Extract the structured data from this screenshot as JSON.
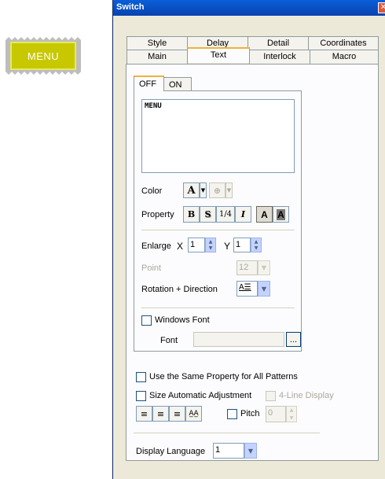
{
  "canvas": {
    "menu_switch_label": "MENU"
  },
  "dialog": {
    "title": "Switch",
    "close_glyph": "✕",
    "tabs_row1": [
      "Style",
      "Delay",
      "Detail",
      "Coordinates"
    ],
    "tabs_row2": [
      "Main",
      "Text",
      "Interlock",
      "Macro"
    ],
    "active_tab": "Text"
  },
  "state_tabs": {
    "off": "OFF",
    "on": "ON",
    "active": "OFF"
  },
  "text_value": "MENU",
  "color": {
    "label": "Color",
    "font_color_glyph": "A",
    "bg_color_glyph": "⊕"
  },
  "property": {
    "label": "Property",
    "bold": "B",
    "shadow": "S",
    "fraction": "1/4",
    "italic": "I",
    "normal_a": "A",
    "inverse_a": "A"
  },
  "enlarge": {
    "label": "Enlarge",
    "x_label": "X",
    "x_value": "1",
    "y_label": "Y",
    "y_value": "1"
  },
  "point": {
    "label": "Point",
    "value": "12"
  },
  "rotation": {
    "label": "Rotation + Direction",
    "glyph": "A☰"
  },
  "windows_font": {
    "label": "Windows Font",
    "checked": false
  },
  "font": {
    "label": "Font",
    "value": "",
    "browse": "..."
  },
  "same_property": {
    "label": "Use the Same Property for All Patterns",
    "checked": false
  },
  "size_auto": {
    "label": "Size Automatic Adjustment",
    "checked": false
  },
  "four_line": {
    "label": "4-Line Display",
    "checked": false
  },
  "align": {
    "left": "≡",
    "center": "≡",
    "right": "≡",
    "spacing": "A̲A̲"
  },
  "pitch": {
    "label": "Pitch",
    "value": "0",
    "checked": false
  },
  "display_language": {
    "label": "Display Language",
    "value": "1"
  }
}
